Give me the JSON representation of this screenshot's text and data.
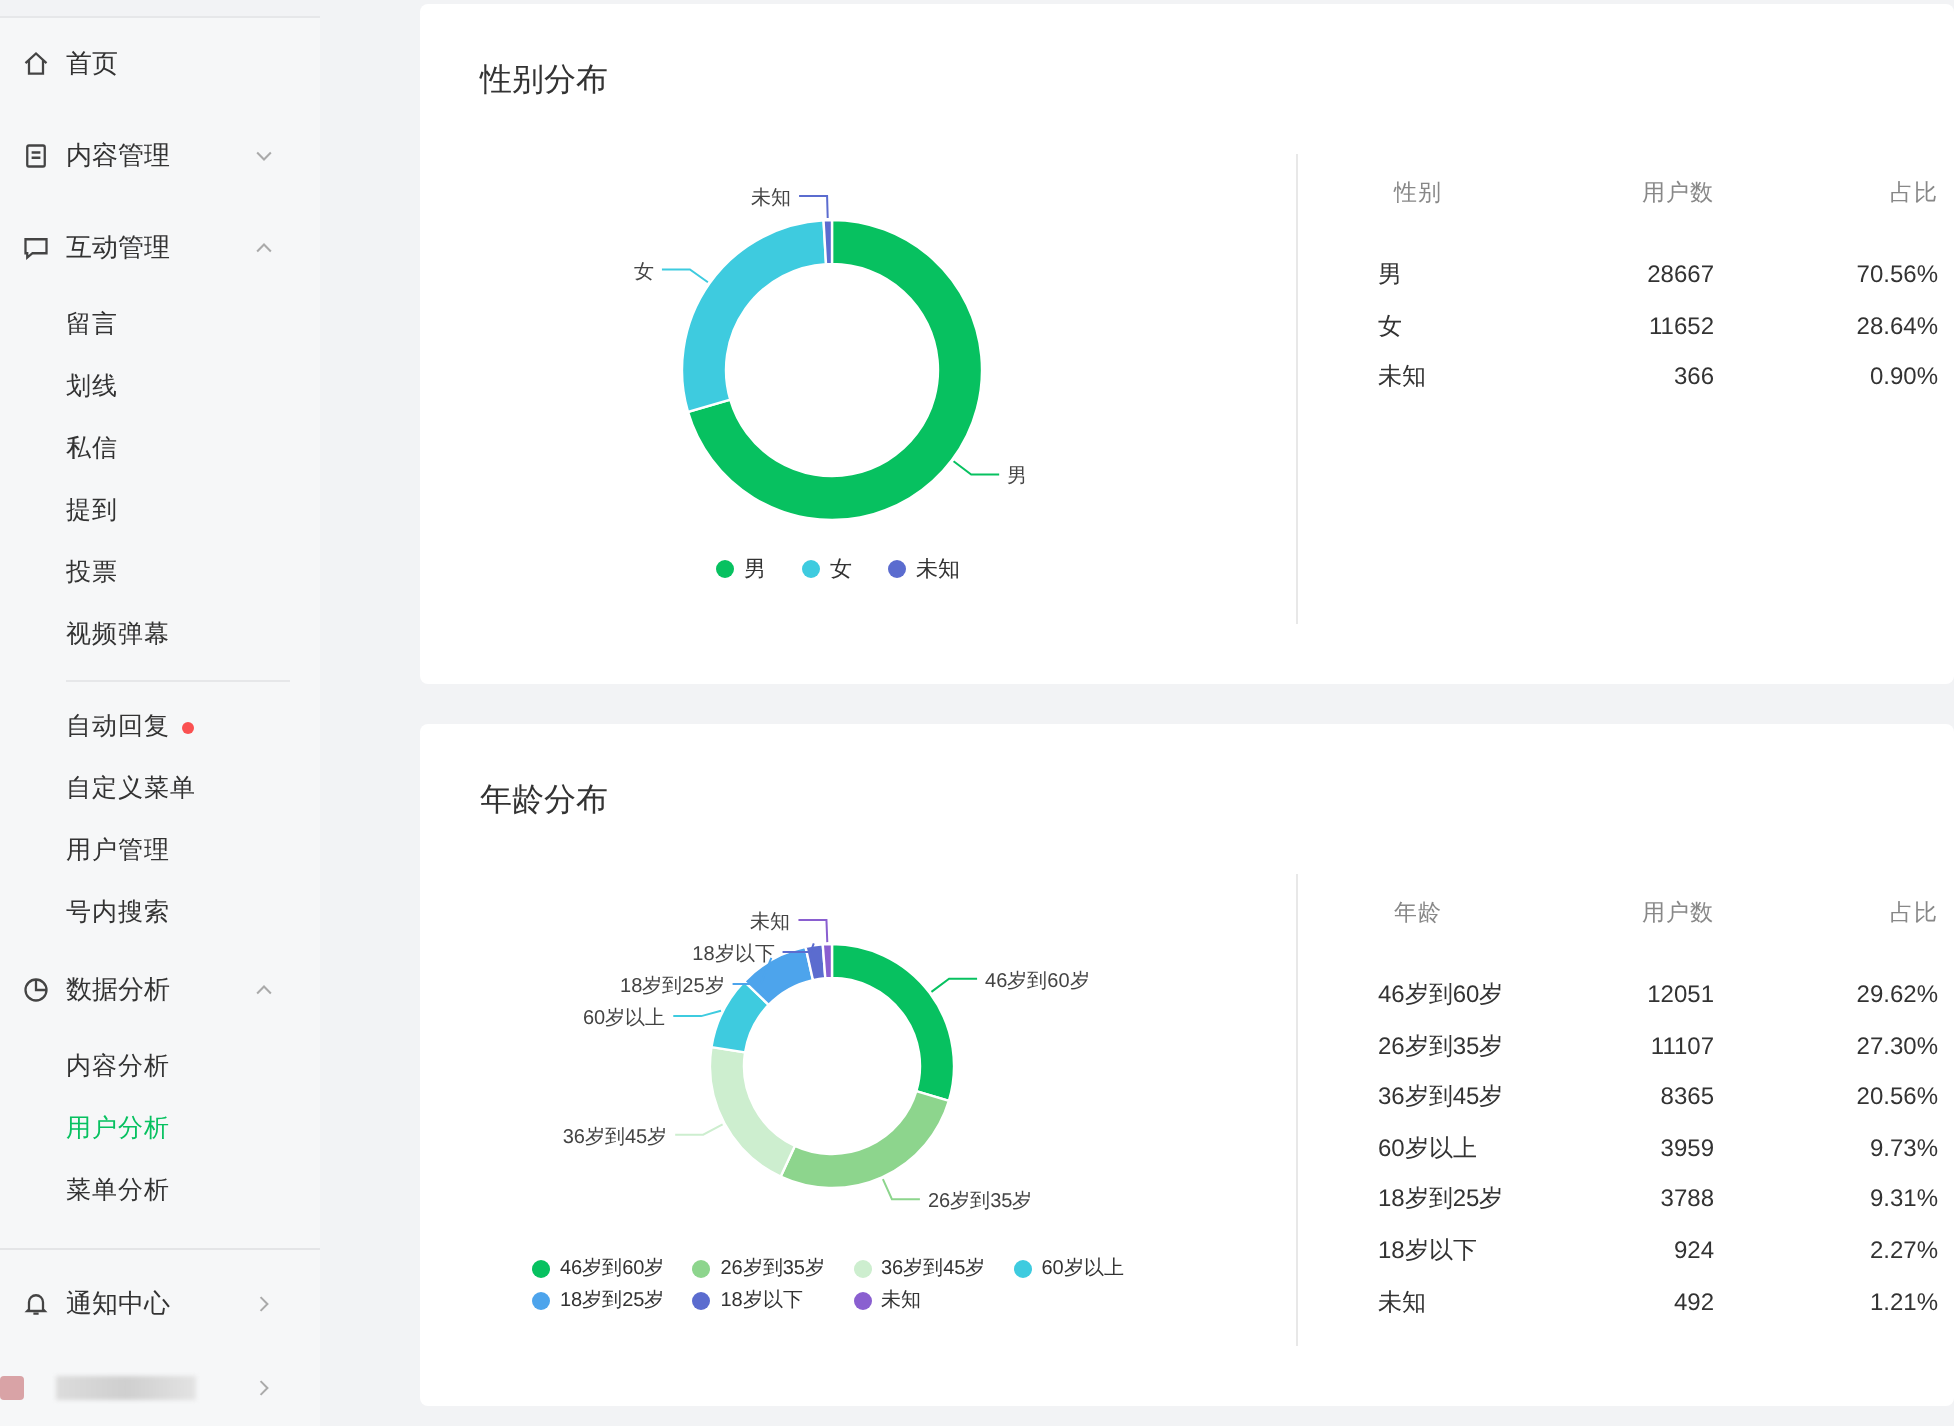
{
  "sidebar": {
    "groups": [
      {
        "label": "首页",
        "kind": "link"
      },
      {
        "label": "内容管理",
        "kind": "folder",
        "expanded": false
      },
      {
        "label": "互动管理",
        "kind": "folder",
        "expanded": true,
        "sections": [
          {
            "items": [
              {
                "label": "留言",
                "selected": false,
                "badge": false
              },
              {
                "label": "划线",
                "selected": false,
                "badge": false
              },
              {
                "label": "私信",
                "selected": false,
                "badge": false
              },
              {
                "label": "提到",
                "selected": false,
                "badge": false
              },
              {
                "label": "投票",
                "selected": false,
                "badge": false
              },
              {
                "label": "视频弹幕",
                "selected": false,
                "badge": false
              }
            ]
          },
          {
            "items": [
              {
                "label": "自动回复",
                "selected": false,
                "badge": true
              },
              {
                "label": "自定义菜单",
                "selected": false,
                "badge": false
              },
              {
                "label": "用户管理",
                "selected": false,
                "badge": false
              },
              {
                "label": "号内搜索",
                "selected": false,
                "badge": false
              }
            ]
          }
        ]
      },
      {
        "label": "数据分析",
        "kind": "folder",
        "expanded": true,
        "sections": [
          {
            "items": [
              {
                "label": "内容分析",
                "selected": false,
                "badge": false
              },
              {
                "label": "用户分析",
                "selected": true,
                "badge": false
              },
              {
                "label": "菜单分析",
                "selected": false,
                "badge": false
              }
            ]
          }
        ]
      }
    ],
    "footer": [
      {
        "kind": "link",
        "label": "通知中心"
      },
      {
        "kind": "account"
      }
    ]
  },
  "cards": [
    {
      "title": "性别分布",
      "chart_data": {
        "type": "donut",
        "categories": [
          "男",
          "女",
          "未知"
        ],
        "colors": [
          "#07c160",
          "#3ecbdf",
          "#5b6ccf"
        ],
        "series": [
          {
            "values": [
              70.56,
              28.64,
              0.9
            ]
          }
        ]
      },
      "table": {
        "columns": [
          "性别",
          "用户数",
          "占比"
        ],
        "rows": [
          [
            "男",
            "28667",
            "70.56%"
          ],
          [
            "女",
            "11652",
            "28.64%"
          ],
          [
            "未知",
            "366",
            "0.90%"
          ]
        ]
      }
    },
    {
      "title": "年龄分布",
      "chart_data": {
        "type": "donut",
        "categories": [
          "46岁到60岁",
          "26岁到35岁",
          "36岁到45岁",
          "60岁以上",
          "18岁到25岁",
          "18岁以下",
          "未知"
        ],
        "colors": [
          "#07c160",
          "#8dd58d",
          "#cdeecf",
          "#3ecbdf",
          "#4da4ec",
          "#5b6ccf",
          "#8a5fd0"
        ],
        "series": [
          {
            "values": [
              29.62,
              27.3,
              20.56,
              9.73,
              9.31,
              2.27,
              1.21
            ]
          }
        ]
      },
      "table": {
        "columns": [
          "年龄",
          "用户数",
          "占比"
        ],
        "rows": [
          [
            "46岁到60岁",
            "12051",
            "29.62%"
          ],
          [
            "26岁到35岁",
            "11107",
            "27.30%"
          ],
          [
            "36岁到45岁",
            "8365",
            "20.56%"
          ],
          [
            "60岁以上",
            "3959",
            "9.73%"
          ],
          [
            "18岁到25岁",
            "3788",
            "9.31%"
          ],
          [
            "18岁以下",
            "924",
            "2.27%"
          ],
          [
            "未知",
            "492",
            "1.21%"
          ]
        ]
      }
    }
  ]
}
